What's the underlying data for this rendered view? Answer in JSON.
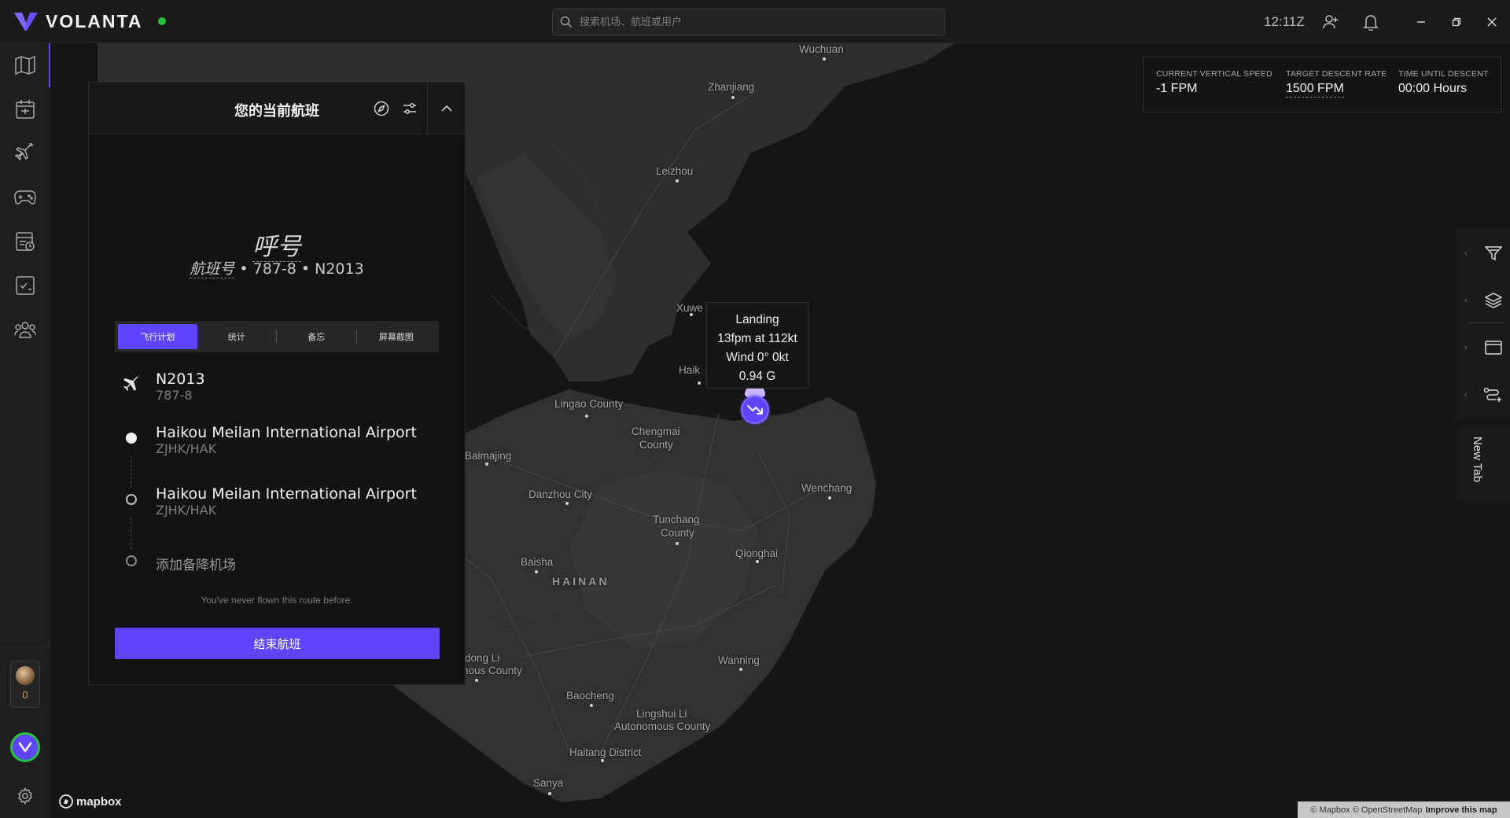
{
  "app": {
    "name": "VOLANTA",
    "clock": "12:11Z"
  },
  "search": {
    "placeholder": "搜索机场、航班或用户"
  },
  "colors": {
    "accent": "#5e45ff",
    "online": "#26c13f",
    "background": "#171717"
  },
  "sidebar": {
    "items": [
      {
        "name": "map",
        "icon": "map-icon"
      },
      {
        "name": "flight-planner",
        "icon": "planner-icon"
      },
      {
        "name": "flights",
        "icon": "plane-icon"
      },
      {
        "name": "simulator",
        "icon": "gamepad-icon"
      },
      {
        "name": "logbook",
        "icon": "logbook-icon"
      },
      {
        "name": "checklists",
        "icon": "checklist-icon"
      },
      {
        "name": "friends",
        "icon": "friends-icon"
      }
    ],
    "avatar_count": "0"
  },
  "panel": {
    "title": "您的当前航班",
    "callsign": "呼号",
    "flight_number": "航班号",
    "aircraft_type": "787-8",
    "registration": "N2013",
    "tabs": [
      "飞行计划",
      "统计",
      "备忘",
      "屏幕截图"
    ],
    "active_tab": 0,
    "aircraft_row": {
      "reg": "N2013",
      "type": "787-8"
    },
    "departure": {
      "name": "Haikou Meilan International Airport",
      "code": "ZJHK/HAK"
    },
    "arrival": {
      "name": "Haikou Meilan International Airport",
      "code": "ZJHK/HAK"
    },
    "alternate_placeholder": "添加备降机场",
    "route_note": "You've never flown this route before.",
    "end_button": "结束航班"
  },
  "descent": {
    "vs_label": "CURRENT VERTICAL SPEED",
    "vs_value": "-1 FPM",
    "rate_label": "TARGET DESCENT RATE",
    "rate_value": "1500 FPM",
    "time_label": "TIME UNTIL DESCENT",
    "time_value": "00:00 Hours"
  },
  "tooltip": {
    "title": "Landing",
    "rate_speed": "13fpm at 112kt",
    "wind": "Wind 0° 0kt",
    "gforce": "0.94 G"
  },
  "map_labels": [
    "Wuchuan",
    "Zhanjiang",
    "Leizhou",
    "Xuwe",
    "Haik",
    "Lingao County",
    "Chengmai",
    "County",
    "Baimajing",
    "Danzhou City",
    "Wenchang",
    "Tunchang",
    "County",
    "Qionghai",
    "Baisha",
    "HAINAN",
    "Wanning",
    "dong Li",
    "nous County",
    "Baocheng",
    "Lingshui Li",
    "Autonomous County",
    "Haitang District",
    "Sanya"
  ],
  "right_tools": [
    "filter-icon",
    "layers-icon",
    "window-icon",
    "route-icon"
  ],
  "new_tab": "New Tab",
  "mapbox": "mapbox",
  "attribution": {
    "text": "© Mapbox © OpenStreetMap",
    "improve": "Improve this map"
  }
}
